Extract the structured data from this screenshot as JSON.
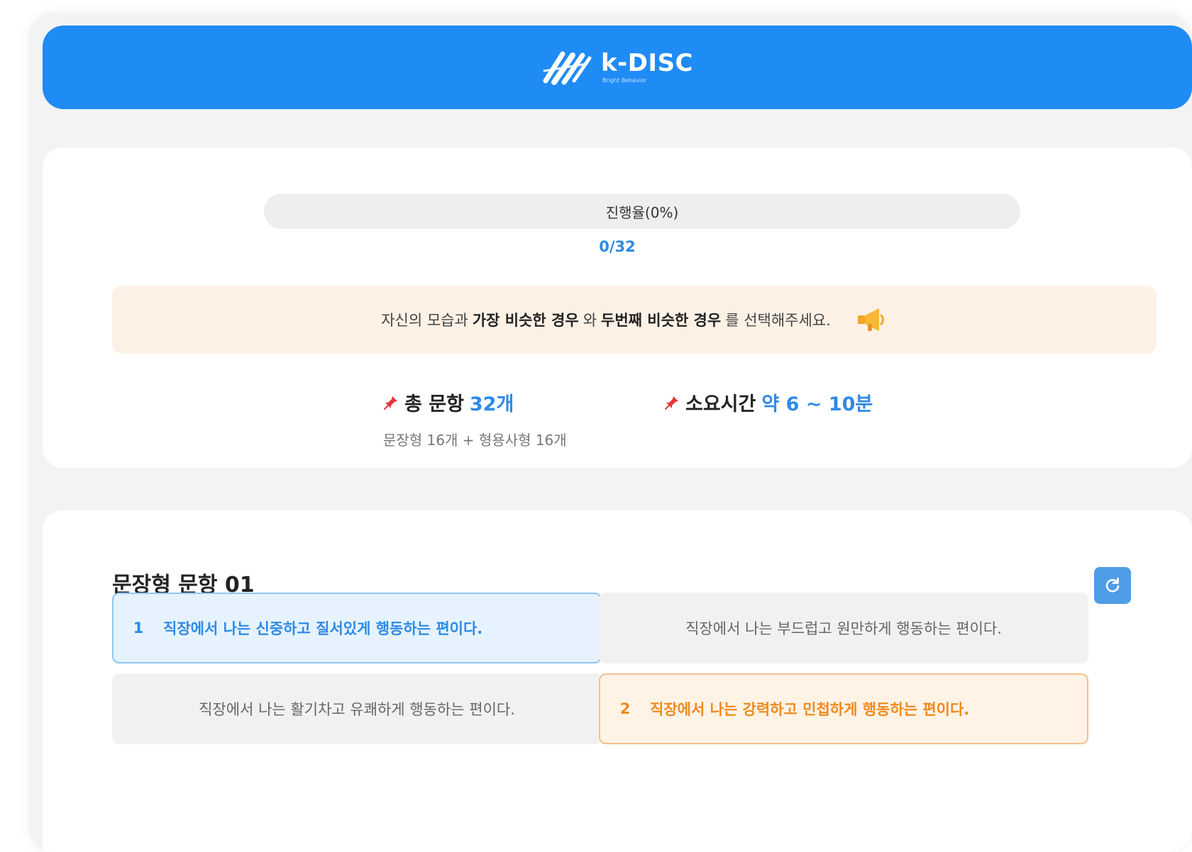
{
  "colors": {
    "primary": "#1f8bf5",
    "accent_blue": "#2e8ae6",
    "accent_orange": "#f08a1c",
    "notice_bg": "#fdf1e6",
    "refresh_bg": "#4e9de6"
  },
  "header": {
    "brand": "k-DISC",
    "tagline": "Bright Behavior",
    "logo_icon": "brush-stroke-logo-icon"
  },
  "progress": {
    "label": "진행율(0%)",
    "percent": 0,
    "count": "0/32"
  },
  "notice": {
    "part1": "자신의 모습과 ",
    "bold1": "가장 비슷한 경우",
    "part2": "와 ",
    "bold2": "두번째 비슷한 경우",
    "part3": "를 선택해주세요.",
    "icon": "megaphone-icon"
  },
  "stats": {
    "total": {
      "icon": "pin-icon",
      "label": "총 문항",
      "value": "32개",
      "sub": "문장형 16개 + 형용사형 16개"
    },
    "time": {
      "icon": "pin-icon",
      "label": "소요시간",
      "value": "약 6 ~ 10분"
    }
  },
  "question": {
    "title": "문장형 문항 01",
    "refresh_icon": "refresh-icon",
    "options": [
      {
        "rank": "1",
        "text": "직장에서 나는 신중하고 질서있게 행동하는 편이다."
      },
      {
        "rank": "",
        "text": "직장에서 나는 부드럽고 원만하게 행동하는 편이다."
      },
      {
        "rank": "",
        "text": "직장에서 나는 활기차고 유쾌하게 행동하는 편이다."
      },
      {
        "rank": "2",
        "text": "직장에서 나는 강력하고 민첩하게 행동하는 편이다."
      }
    ]
  }
}
